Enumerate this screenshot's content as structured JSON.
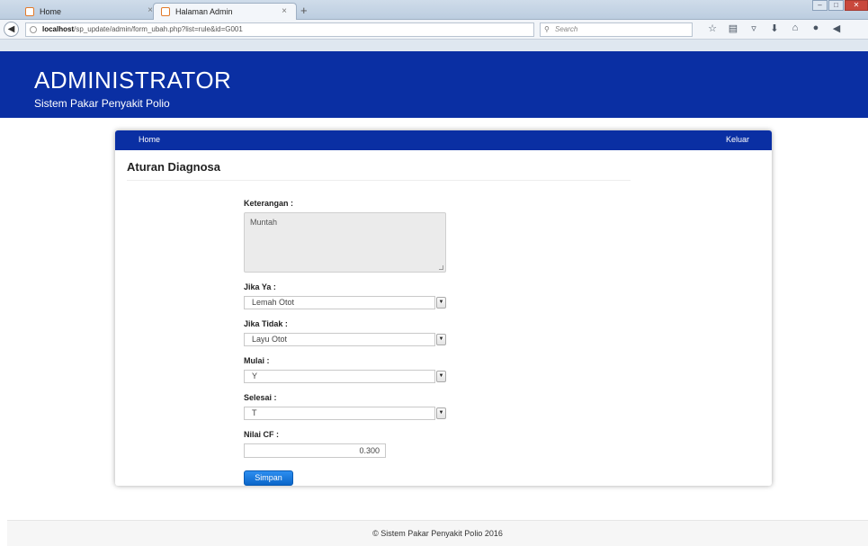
{
  "browser": {
    "tabs": [
      {
        "label": "Home"
      },
      {
        "label": "Halaman Admin"
      }
    ],
    "tab_close": "×",
    "new_tab": "+",
    "url_host": "localhost",
    "url_path": "/sp_update/admin/form_ubah.php?list=rule&id=G001",
    "search_placeholder": "Search"
  },
  "header": {
    "title": "ADMINISTRATOR",
    "subtitle": "Sistem Pakar Penyakit Polio"
  },
  "nav": {
    "home": "Home",
    "logout": "Keluar"
  },
  "section": {
    "title": "Aturan Diagnosa"
  },
  "form": {
    "keterangan_label": "Keterangan :",
    "keterangan_value": "Muntah",
    "jika_ya_label": "Jika Ya :",
    "jika_ya_value": "Lemah Otot",
    "jika_tidak_label": "Jika Tidak :",
    "jika_tidak_value": "Layu Otot",
    "mulai_label": "Mulai :",
    "mulai_value": "Y",
    "selesai_label": "Selesai :",
    "selesai_value": "T",
    "nilai_cf_label": "Nilai CF :",
    "nilai_cf_value": "0.300",
    "save_label": "Simpan"
  },
  "footer": {
    "text": "© Sistem Pakar Penyakit Polio 2016"
  },
  "colors": {
    "brand_blue": "#0a2fa3",
    "button_blue": "#0b66c9"
  }
}
